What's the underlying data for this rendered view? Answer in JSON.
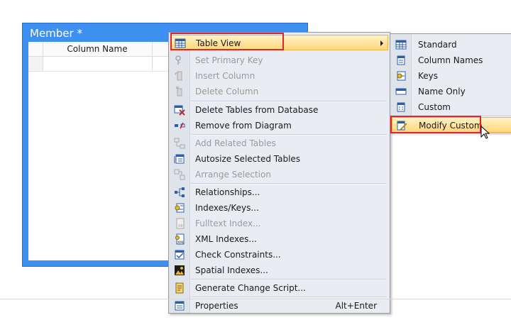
{
  "table": {
    "title": "Member *",
    "column_header": "Column Name"
  },
  "menu": {
    "items": [
      {
        "label": "Table View",
        "icon": "table-view-icon",
        "enabled": true,
        "submenu": true,
        "highlighted": true
      },
      {
        "label": "Set Primary Key",
        "icon": "primary-key-icon",
        "enabled": false
      },
      {
        "label": "Insert Column",
        "icon": "insert-column-icon",
        "enabled": false
      },
      {
        "label": "Delete Column",
        "icon": "delete-column-icon",
        "enabled": false
      },
      {
        "label": "Delete Tables from Database",
        "icon": "delete-table-icon",
        "enabled": true
      },
      {
        "label": "Remove from Diagram",
        "icon": "remove-diagram-icon",
        "enabled": true
      },
      {
        "label": "Add Related Tables",
        "icon": "add-related-icon",
        "enabled": false
      },
      {
        "label": "Autosize Selected Tables",
        "icon": "autosize-icon",
        "enabled": true
      },
      {
        "label": "Arrange Selection",
        "icon": "arrange-icon",
        "enabled": false
      },
      {
        "label": "Relationships...",
        "icon": "relationships-icon",
        "enabled": true
      },
      {
        "label": "Indexes/Keys...",
        "icon": "indexes-icon",
        "enabled": true
      },
      {
        "label": "Fulltext Index...",
        "icon": "fulltext-icon",
        "enabled": false
      },
      {
        "label": "XML Indexes...",
        "icon": "xml-icon",
        "enabled": true
      },
      {
        "label": "Check Constraints...",
        "icon": "constraints-icon",
        "enabled": true
      },
      {
        "label": "Spatial Indexes...",
        "icon": "spatial-icon",
        "enabled": true
      },
      {
        "label": "Generate Change Script...",
        "icon": "script-icon",
        "enabled": true
      },
      {
        "label": "Properties",
        "icon": "properties-icon",
        "enabled": true,
        "shortcut": "Alt+Enter"
      }
    ]
  },
  "submenu": {
    "items": [
      {
        "label": "Standard",
        "icon": "standard-view-icon"
      },
      {
        "label": "Column Names",
        "icon": "column-names-icon"
      },
      {
        "label": "Keys",
        "icon": "keys-icon"
      },
      {
        "label": "Name Only",
        "icon": "name-only-icon"
      },
      {
        "label": "Custom",
        "icon": "custom-view-icon"
      },
      {
        "label": "Modify Custom",
        "icon": "modify-custom-icon",
        "highlighted": true
      }
    ]
  },
  "colors": {
    "table_blue": "#3d8ff0",
    "highlight": "#ffd67a",
    "red_box": "#e0262c"
  }
}
